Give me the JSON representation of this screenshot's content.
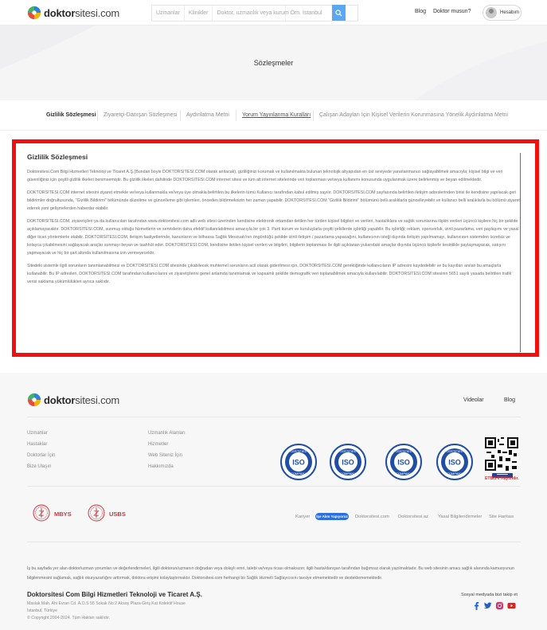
{
  "brand": {
    "name_bold": "doktor",
    "name_light": "sitesi.com"
  },
  "header": {
    "search_specialties": "Uzmanlar",
    "search_clinics": "Klinikler",
    "search_input_placeholder": "Doktor, uzmanlık veya kurum",
    "search_location_placeholder": "Örn. İstanbul",
    "blog": "Blog",
    "are_you_doctor": "Doktor musun?",
    "account": "Hesabım"
  },
  "hero": {
    "title": "Sözleşmeler"
  },
  "tabs": [
    {
      "label": "Gizlilik Sözleşmesi"
    },
    {
      "label": "Ziyaretçi-Danışan Sözleşmesi"
    },
    {
      "label": "Aydınlatma Metni"
    },
    {
      "label": "Yorum Yayınlanma Kuralları"
    },
    {
      "label": "Çalışan Adayları İçin Kişisel Verilerin Korunmasına Yönelik Aydınlatma Metni"
    }
  ],
  "content": {
    "title": "Gizlilik Sözleşmesi",
    "paragraphs": [
      "Doktorsitesi.Com Bilgi Hizmetleri Teknoloji ve Ticaret A.Ş.(Bundan böyle DOKTORSITESI.COM olarak anılacak), gizliliğinizi korumak ve kullanılmakta bulunan teknolojik altyapıdan en üst seviyede yararlanmanızı sağlayabilmek amacıyla; kişisel bilgi ve veri güvenliğiniz için çeşitli gizlilik ilkeleri benimsemiştir. Bu gizlilik ilkeleri dahilinde DOKTORSITESI.COM internet sitesi ve tüm alt internet sitelerinde veri toplanması ve/veya kullanımı konusunda uygulanmak üzere belirlenmiş ve beyan edilmektedir.",
      "DOKTORSITESI.COM internet sitesini ziyaret etmekle ve/veya kullanmakla ve/veya üye olmakla belirtilen bu ilkelerin tümü Kullanıcı tarafından kabul edilmiş sayılır. DOKTORSITESI.COM sayfasında belirtilen iletişim adreslerinden birisi ile kendisine yapılacak geri bildirimler doğrultusunda, \"Gizlilik Bildirimi\" bölümünde düzeltme ve güncelleme gibi işlemleri, önceden bildirmeksizin her zaman yapabilir. DOKTORSITESI.COM \"Gizlilik Bildirimi\" bölümünü belli aralıklarla güncelleyebilir ve kullanıcı belli aralıklarla bu bölümü ziyaret ederek yeni gelişmelerden haberdar olabilir.",
      "DOKTORSITESI.COM, ziyaretçileri ya da kullanıcıları tarafından www.doktorsitesi.com adlı web sitesi üzerinden kendisine elektronik ortamdan iletilen her türden kişisel bilgileri ve verileri, hastalıklara ve sağlık sorunlarına ilişkin verileri üçüncü kişilere hiç bir şekilde açıklamayacaktır. DOKTORSITESI.COM, sunmuş olduğu hizmetlerin ve servislerin daha efektif kullanılabilmesi amacıyla bir çok 3. Parti kurum ve kuruluşlarla çeşitli şekillerde işbirliği yapabilir. Bu işbirliği; reklam, sponsorluk, izinli pazarlama, veri paylaşımı ve yasal diğer ticari yöntemlerle olabilir. DOKTORSITESI.COM, iletişim faaliyetlerinde, kanunların ve bilhassa Sağlık Mevzuatı'nın öngördüğü şekilde izinli iletişim / pazarlama yapacağını, kullanıcının isteği dışında iletişim yapılmamayı, kullanıcının sistemden ücretsiz ve kolayca çıkabilmesini sağlayacak araçlar sunmayı beyan ve taahhüt eder. DOKTORSITESI.COM, kendisine iletilen kişisel verileri ve bilgileri, bilgilerin toplanması ile ilgili açıklanan yukarıdaki amaçlar dışında üçüncü kişilerle kesinlikle paylaşmayacak, satışını yapmayacak ve hiç bir şart altında kullanılmasına izin vermeyecektir.",
      "Sitedeki sistemle ilgili sorunların tanımlanabilmesi ve DOKTORSITESI.COM sitesinde çıkabilecek muhtemel sorunların acil olarak giderilmesi için, DOKTORSITESI.COM gerektiğinde kullanıcıların IP adresini kaydedebilir ve bu kayıtları anılan bu amaçlarla kullanabilir. Bu IP adresleri, DOKTORSITESI.COM tarafından kullanıcılarını ve ziyaretçilerini genel anlamda tanımlamak ve kapsamlı şekilde demografik veri toplanabilmek amacıyla kullanılabilir. DOKTORSITESI.COM sitesinin 5651 sayılı yasada belirtilen trafik verisi saklama yükümlülükleri ayrıca saklıdır."
    ]
  },
  "footer": {
    "top_links": [
      "Videolar",
      "Blog"
    ],
    "col1": [
      "Uzmanlar",
      "Hastaklar",
      "Doktorlar İçin",
      "Bize Ulaşın"
    ],
    "col2": [
      "Uzmanlık Alanları",
      "Hizmetler",
      "Web Siteniz İçin",
      "Hakkımızda"
    ],
    "iso_badges": [
      {
        "top": "CERTIFIED",
        "mid": "ISO",
        "bottom": "COMPANY"
      },
      {
        "top": "CERTIFIED",
        "mid": "ISO",
        "bottom": "COMPANY"
      },
      {
        "top": "CERTIFIED",
        "mid": "ISO",
        "bottom": "COMPANY"
      },
      {
        "top": "CERTIFIED",
        "mid": "ISO",
        "bottom": "COMPANY"
      }
    ],
    "etbis_label": "ETBİS'e Kayıtlıdır.",
    "gov_labels": [
      "MBYS",
      "USBS"
    ],
    "careers": "Kariyer",
    "hiring_badge": "İşe Alım Yapıyoruz",
    "links_right": [
      "Doktorsitesi.com",
      "Doktorsitesi.az",
      "Yasal Bilgilendirmeler",
      "Site Haritası"
    ],
    "disclaimer": "İş bu sayfada yer alan doktor/uzman yorumları ve değerlendirmeleri, ilgili doktorun/uzmanın doğrudan veya dolaylı emri, talebi ve/veya ricası olmaksızın; ilgili hasta/danışan tarafından bağımsız olarak yazılmaktadır. Bu web sitesinin amacı sağlık alanında kamuoyunun bilgilenmesini sağlamak, sağlık okuryazarlığını arttırmak, doktora erişimi kolaylaştırmaktır. Doktorsitesi.com herhangi bir Sağlık Hizmeti Sağlayıcısını tavsiye etmemektedir ve desteklememektedir.",
    "company_name": "Doktorsitesi Com Bilgi Hizmetleri Teknoloji ve Ticaret A.Ş.",
    "address_line1": "Maslak Mah. Ahi Evran Cd. A.O.S 55 Sokak No:2 Aksoy Plaza Giriş Kat Kolektif House",
    "address_line2": "İstanbul, Türkiye",
    "copyright": "© Copyright 2004-2024. Tüm Hakları saklıdır.",
    "social_label": "Sosyal medyada bizi takip et",
    "social_icons": [
      "facebook-icon",
      "twitter-icon",
      "instagram-icon",
      "youtube-icon"
    ]
  },
  "colors": {
    "accent_blue": "#5aa7f2",
    "highlight_red": "#f20f0f",
    "brand_blue": "#2b6fe0",
    "gov_red": "#d0343a"
  }
}
